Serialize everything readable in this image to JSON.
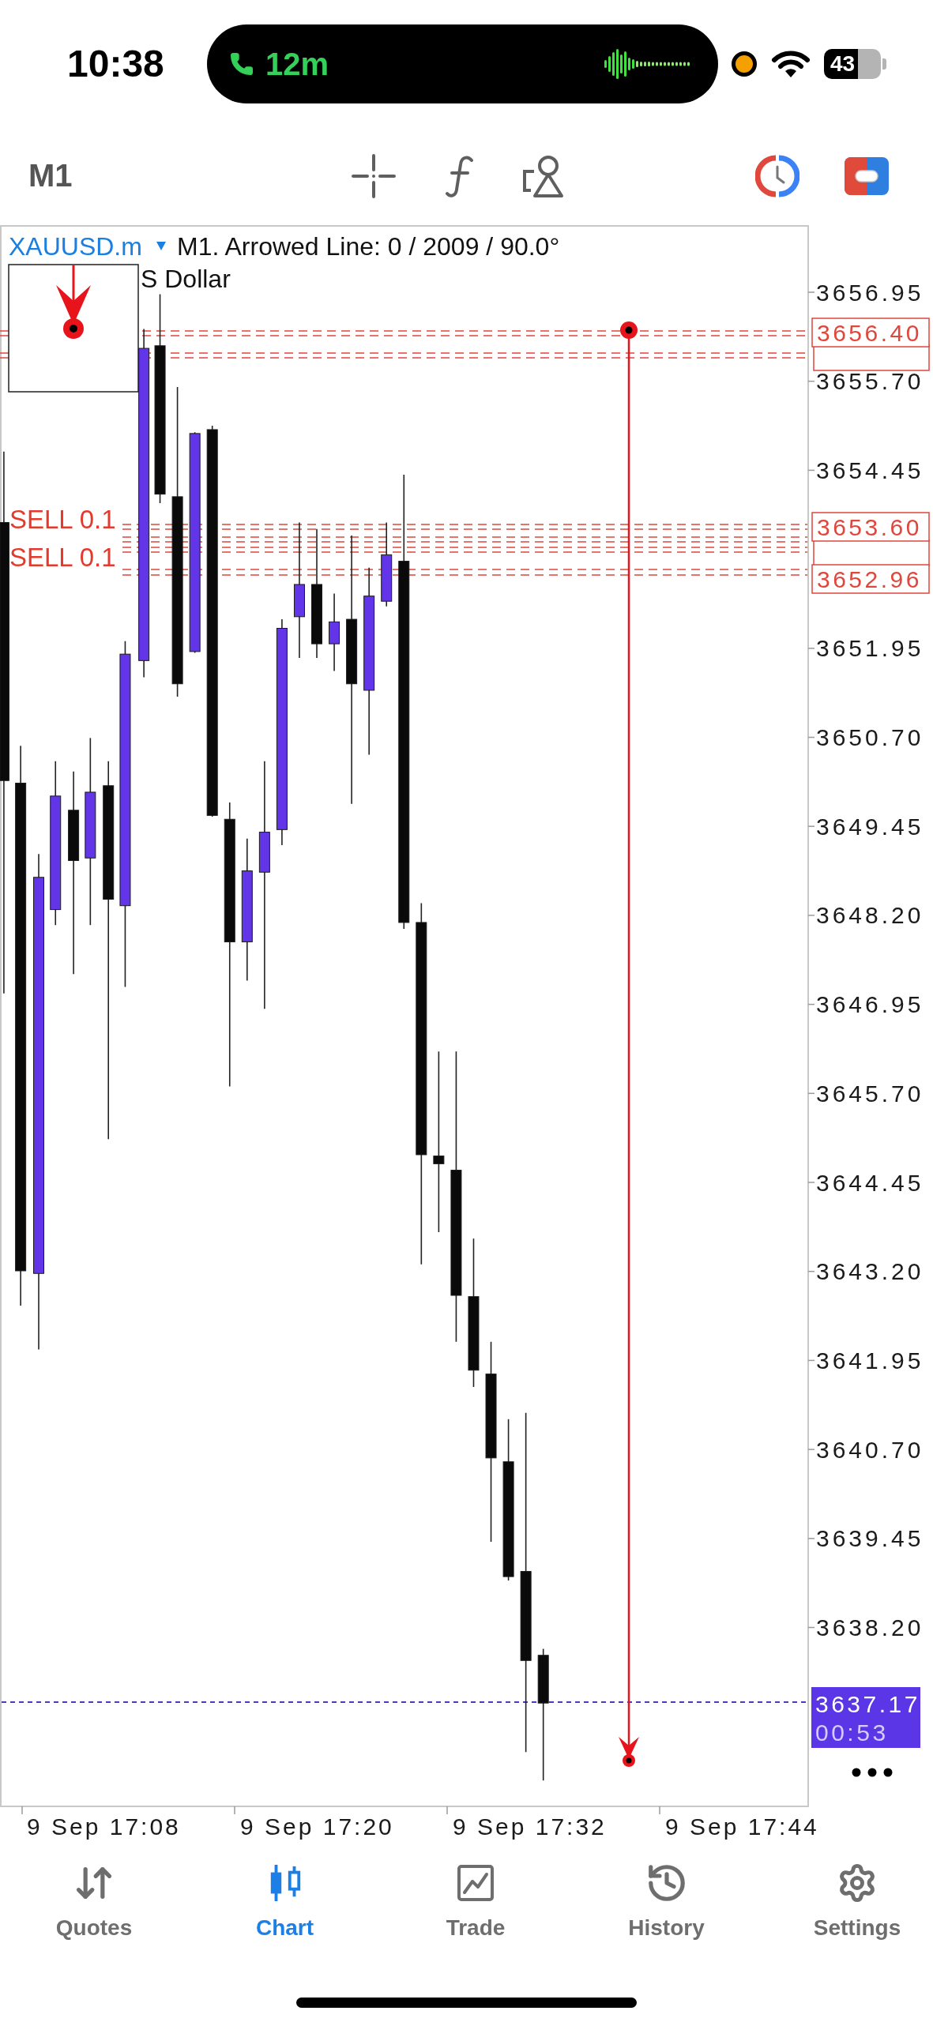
{
  "status_bar": {
    "time": "10:38",
    "call_duration": "12m",
    "battery": "43"
  },
  "toolbar": {
    "timeframe": "M1"
  },
  "chart": {
    "symbol": "XAUUSD.m",
    "object_info": "M1. Arrowed Line: 0 / 2009 / 90.0°",
    "indicator_label": "S Dollar",
    "order_labels": [
      "SELL 0.1",
      "SELL 0.1"
    ],
    "price_axis": [
      "3656.95",
      "3655.70",
      "3654.45",
      "3651.95",
      "3650.70",
      "3649.45",
      "3648.20",
      "3646.95",
      "3645.70",
      "3644.45",
      "3643.20",
      "3641.95",
      "3640.70",
      "3639.45",
      "3638.20"
    ],
    "price_tags": [
      "3656.40",
      "3653.60",
      "3652.96"
    ],
    "current_price": {
      "price": "3637.17",
      "countdown": "00:53"
    },
    "time_axis": [
      "9 Sep 17:08",
      "9 Sep 17:20",
      "9 Sep 17:32",
      "9 Sep 17:44"
    ]
  },
  "tab_bar": [
    {
      "label": "Quotes",
      "selected": false
    },
    {
      "label": "Chart",
      "selected": true
    },
    {
      "label": "Trade",
      "selected": false
    },
    {
      "label": "History",
      "selected": false
    },
    {
      "label": "Settings",
      "selected": false
    }
  ]
}
